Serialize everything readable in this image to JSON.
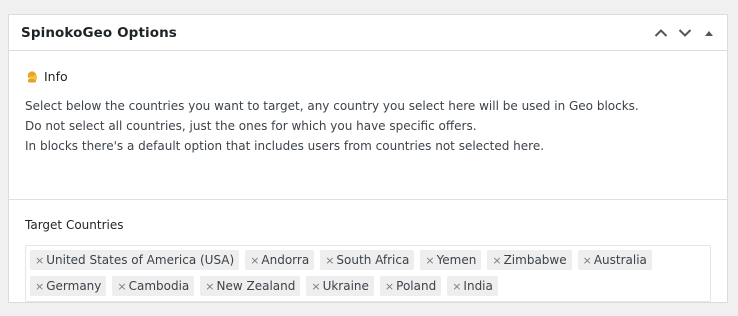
{
  "panel": {
    "title": "SpinokoGeo Options",
    "actions": [
      {
        "icon": "chevron-up-icon",
        "label": "Move up"
      },
      {
        "icon": "chevron-down-icon",
        "label": "Move down"
      },
      {
        "icon": "triangle-up-icon",
        "label": "Toggle panel"
      }
    ]
  },
  "info": {
    "emoji_icon": "info-emoji-icon",
    "heading": "Info",
    "lines": [
      "Select below the countries you want to target, any country you select here will be used in Geo blocks.",
      "Do not select all countries, just the ones for which you have specific offers.",
      "In blocks there's a default option that includes users from countries not selected here."
    ]
  },
  "target": {
    "label": "Target Countries",
    "remove_glyph": "×",
    "countries": [
      "United States of America (USA)",
      "Andorra",
      "South Africa",
      "Yemen",
      "Zimbabwe",
      "Australia",
      "Germany",
      "Cambodia",
      "New Zealand",
      "Ukraine",
      "Poland",
      "India"
    ]
  },
  "colors": {
    "page_bg": "#f0f0f1",
    "panel_bg": "#ffffff",
    "border": "#dcdcde",
    "token_bg": "#eeeeee",
    "text": "#1d2327",
    "muted": "#3c434a"
  }
}
